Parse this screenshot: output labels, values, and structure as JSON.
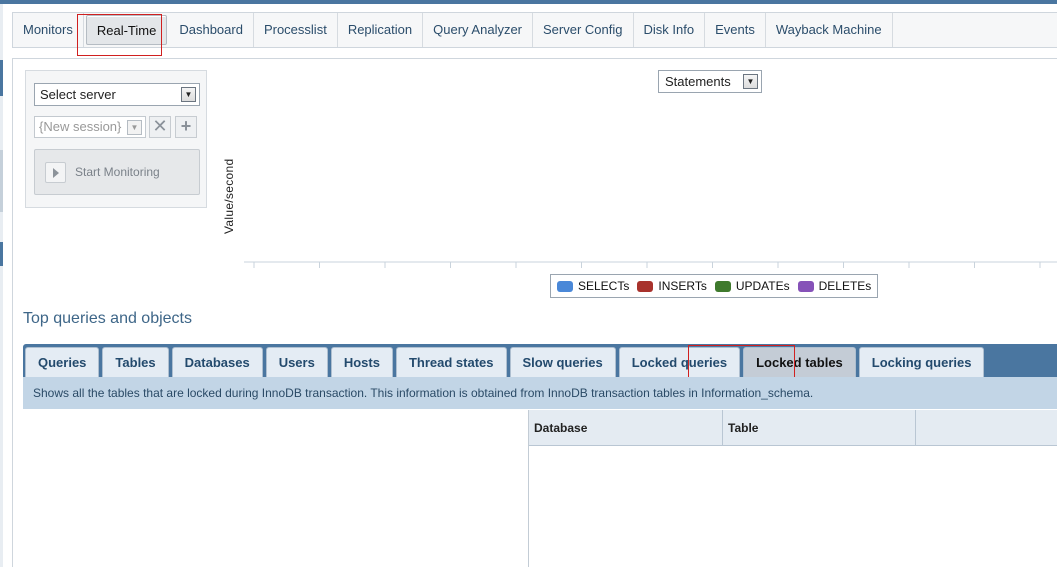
{
  "nav": {
    "tabs": [
      "Monitors",
      "Real-Time",
      "Dashboard",
      "Processlist",
      "Replication",
      "Query Analyzer",
      "Server Config",
      "Disk Info",
      "Events",
      "Wayback Machine"
    ],
    "active": "Real-Time"
  },
  "control": {
    "server_select": "Select server",
    "session_select": "{New session}",
    "start_button": "Start Monitoring"
  },
  "chart_data": {
    "type": "line",
    "metric_select": "Statements",
    "ylabel": "Value/second",
    "series": [
      {
        "name": "SELECTs",
        "color": "#4a88d8",
        "values": []
      },
      {
        "name": "INSERTs",
        "color": "#a8322c",
        "values": []
      },
      {
        "name": "UPDATEs",
        "color": "#3f7a2d",
        "values": []
      },
      {
        "name": "DELETEs",
        "color": "#8652b8",
        "values": []
      }
    ],
    "grid": false,
    "legend": "bottom-center"
  },
  "section": {
    "title": "Top queries and objects",
    "tabs": [
      "Queries",
      "Tables",
      "Databases",
      "Users",
      "Hosts",
      "Thread states",
      "Slow queries",
      "Locked queries",
      "Locked tables",
      "Locking queries"
    ],
    "active_tab": "Locked tables",
    "description": "Shows all the tables that are locked during InnoDB transaction. This information is obtained from InnoDB transaction tables in Information_schema.",
    "columns": [
      "Database",
      "Table"
    ]
  }
}
